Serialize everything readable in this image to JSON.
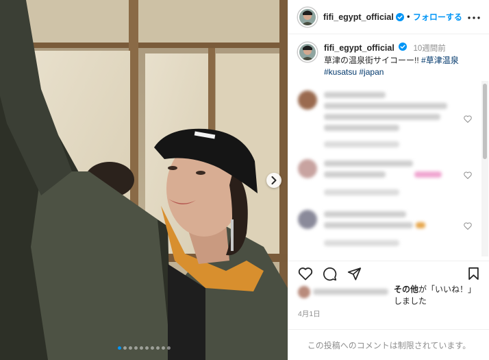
{
  "post": {
    "username": "fifi_egypt_official",
    "follow_label": "フォローする",
    "separator": "•",
    "caption": {
      "time_ago": "10週間前",
      "text": "草津の温泉街サイコーー!!",
      "hashtags": [
        "#草津温泉",
        "#kusatsu",
        "#japan"
      ]
    },
    "likes": {
      "prefix": "その他",
      "suffix": "が「いいね！」しました"
    },
    "date": "4月1日",
    "comments_disabled": "この投稿へのコメントは制限されています。",
    "carousel": {
      "total_slides": 10,
      "active_index": 0
    }
  },
  "icons": {
    "verified": "verified-badge-icon",
    "more": "more-options-icon",
    "like": "heart-icon",
    "comment": "comment-icon",
    "share": "paper-plane-icon",
    "save": "bookmark-icon",
    "next": "chevron-right-icon"
  },
  "colors": {
    "accent": "#0095f6",
    "text": "#262626",
    "muted": "#8e8e8e",
    "link": "#00376b"
  }
}
